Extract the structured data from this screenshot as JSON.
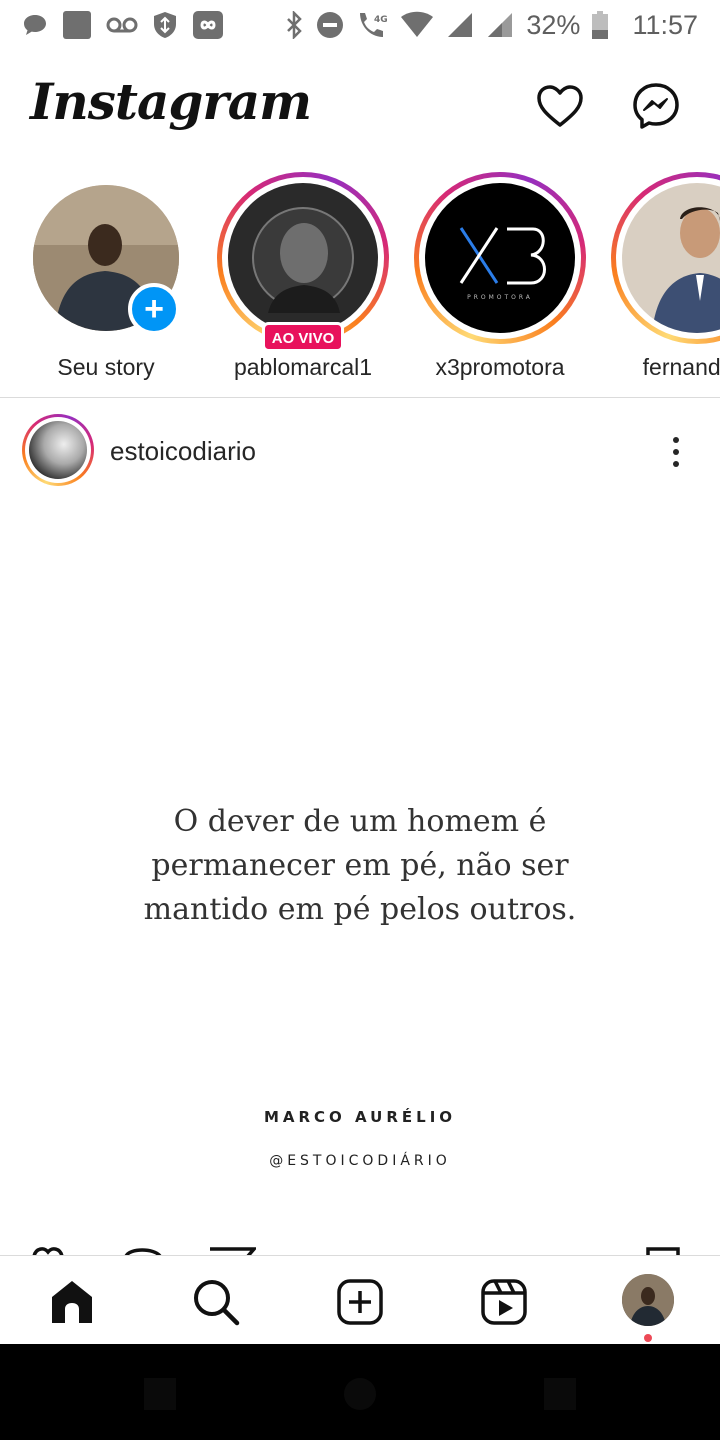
{
  "status_bar": {
    "battery": "32%",
    "time": "11:57",
    "network": "4G",
    "icons": [
      "chat-bubble-icon",
      "gallery-icon",
      "voicemail-icon",
      "vpn-shield-icon",
      "infinity-icon",
      "bluetooth-icon",
      "do-not-disturb-icon",
      "wifi-call-icon",
      "wifi-icon",
      "signal-icon",
      "signal-icon",
      "battery-icon"
    ]
  },
  "header": {
    "logo": "Instagram",
    "icons": [
      "heart-icon",
      "messenger-icon"
    ]
  },
  "stories": [
    {
      "label": "Seu story",
      "own": true
    },
    {
      "label": "pablomarcal1",
      "live_badge": "AO VIVO"
    },
    {
      "label": "x3promotora",
      "avatar_text": "X3",
      "avatar_subtext": "PROMOTORA"
    },
    {
      "label": "fernandinh"
    }
  ],
  "post": {
    "username": "estoicodiario",
    "quote": "O dever de um homem é permanecer em pé, não ser mantido em pé pelos outros.",
    "quote_lines": [
      "O dever de um homem é",
      "permanecer em pé, não ser",
      "mantido em pé pelos outros."
    ],
    "author": "MARCO AURÉLIO",
    "handle": "@ESTOICODIÁRIO"
  },
  "bottom_nav": {
    "items": [
      "home-icon",
      "search-icon",
      "new-post-icon",
      "reels-icon",
      "profile-avatar"
    ]
  },
  "colors": {
    "accent_blue": "#0095f6",
    "live_red": "#e8125c",
    "notification_red": "#ed4956",
    "text": "#262626"
  }
}
